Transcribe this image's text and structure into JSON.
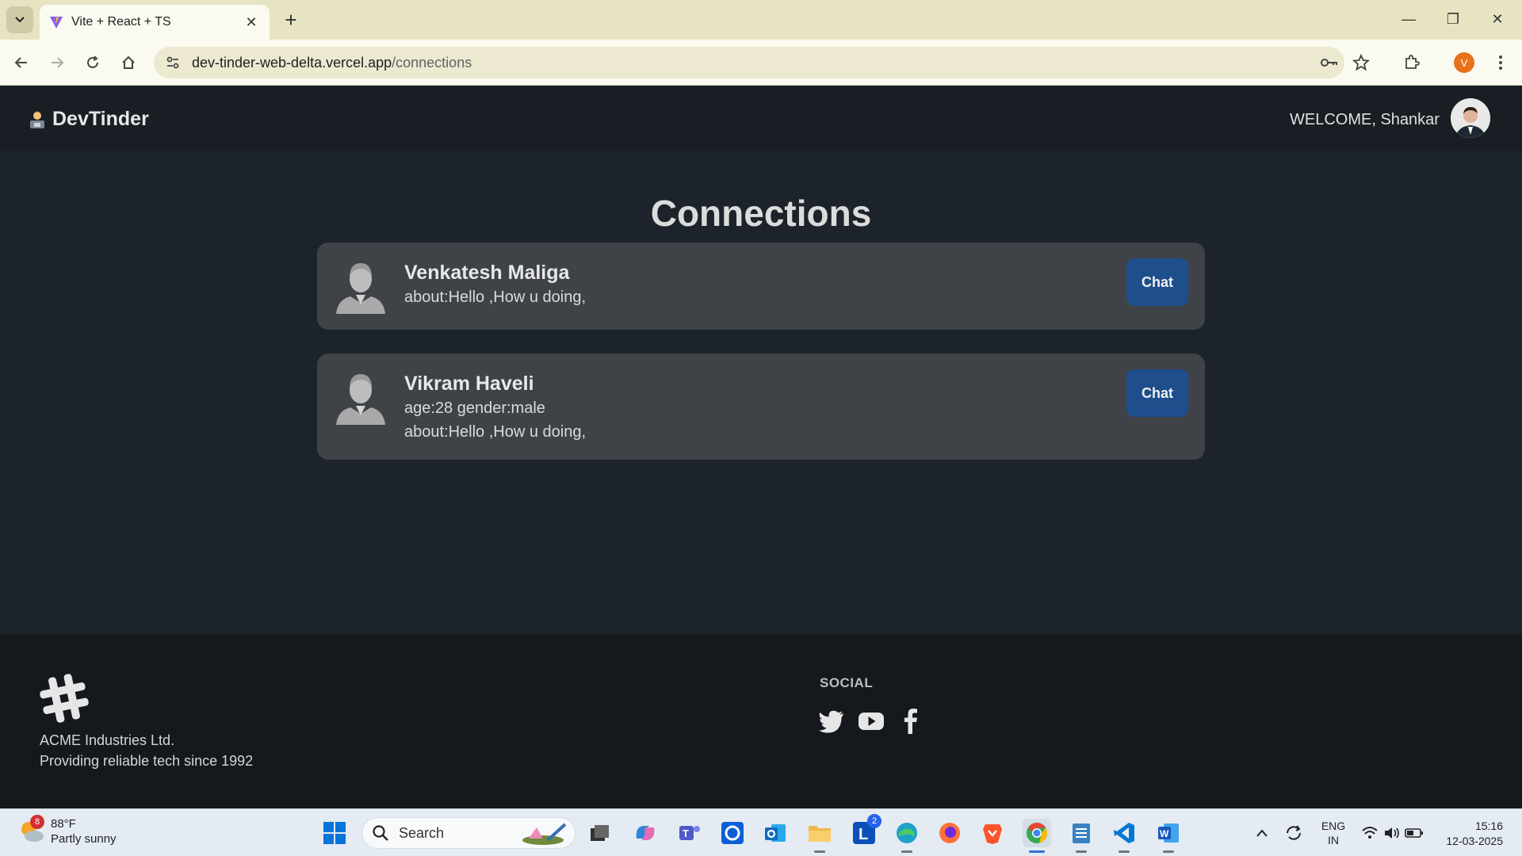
{
  "browser": {
    "tab_title": "Vite + React + TS",
    "url_host": "dev-tinder-web-delta.vercel.app",
    "url_path": "/connections",
    "profile_initial": "V"
  },
  "navbar": {
    "brand": "DevTinder",
    "welcome": "WELCOME, Shankar"
  },
  "page": {
    "title": "Connections"
  },
  "connections": [
    {
      "name": "Venkatesh Maliga",
      "lines": [
        "about:Hello ,How u doing,"
      ],
      "chat_label": "Chat"
    },
    {
      "name": "Vikram Haveli",
      "lines": [
        "age:28  gender:male",
        "about:Hello ,How u doing,"
      ],
      "chat_label": "Chat"
    }
  ],
  "footer": {
    "company": "ACME Industries Ltd.",
    "tagline": "Providing reliable tech since 1992",
    "social_title": "SOCIAL",
    "social_icons": [
      "twitter-icon",
      "youtube-icon",
      "facebook-icon"
    ]
  },
  "taskbar": {
    "weather_temp": "88°F",
    "weather_desc": "Partly sunny",
    "weather_badge": "8",
    "search_label": "Search",
    "lang_top": "ENG",
    "lang_bottom": "IN",
    "time": "15:16",
    "date": "12-03-2025",
    "l_app_badge": "2"
  },
  "colors": {
    "navbar_bg": "#191e24",
    "page_bg": "#1d232a",
    "card_bg": "#3f4348",
    "chat_button": "#1e4e8c",
    "footer_bg": "#15191e"
  }
}
